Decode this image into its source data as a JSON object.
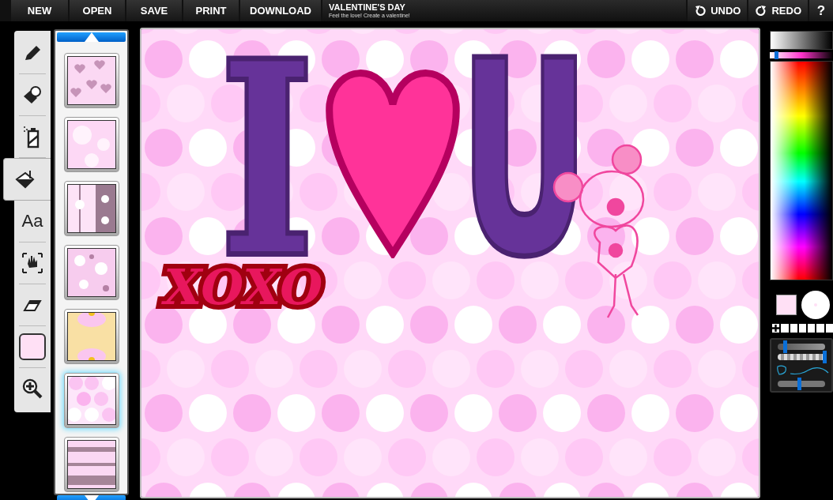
{
  "menu": [
    {
      "label": "NEW"
    },
    {
      "label": "OPEN"
    },
    {
      "label": "SAVE"
    },
    {
      "label": "PRINT"
    },
    {
      "label": "DOWNLOAD"
    }
  ],
  "title": "VALENTINE'S DAY",
  "subtitle": "Feel the love! Create a valentine!",
  "undo": "UNDO",
  "redo": "REDO",
  "help": "?",
  "tools": [
    {
      "kind": "pencil",
      "selected": false
    },
    {
      "kind": "stamp",
      "selected": false
    },
    {
      "kind": "spray",
      "selected": false
    },
    {
      "kind": "bucket",
      "selected": true
    },
    {
      "kind": "text",
      "label": "Aa",
      "selected": false
    },
    {
      "kind": "hand",
      "selected": false
    },
    {
      "kind": "eraser",
      "selected": false
    },
    {
      "kind": "color",
      "selected": false,
      "color": "#ffe0f5"
    },
    {
      "kind": "zoom",
      "selected": false
    }
  ],
  "patterns": [
    {
      "kind": "hearts",
      "selected": false
    },
    {
      "kind": "daisies",
      "selected": false
    },
    {
      "kind": "stripes",
      "selected": false
    },
    {
      "kind": "floral",
      "selected": false
    },
    {
      "kind": "sunflower",
      "selected": false
    },
    {
      "kind": "dots",
      "selected": true
    },
    {
      "kind": "lace",
      "selected": false
    }
  ],
  "canvas": {
    "stickers": [
      {
        "kind": "letter",
        "text": "I"
      },
      {
        "kind": "heart"
      },
      {
        "kind": "letter",
        "text": "U"
      },
      {
        "kind": "word",
        "text": "XOXO"
      },
      {
        "kind": "doodle"
      }
    ]
  },
  "colors": {
    "shade_slider": {
      "level": 0.07
    },
    "current": {
      "color": "#ffe0f5"
    }
  },
  "brush": {
    "size_slider": {
      "level": 0.17
    },
    "opacity_slider": {
      "level": 1.0
    },
    "smoothing_slider": {
      "level": 0.47
    }
  }
}
